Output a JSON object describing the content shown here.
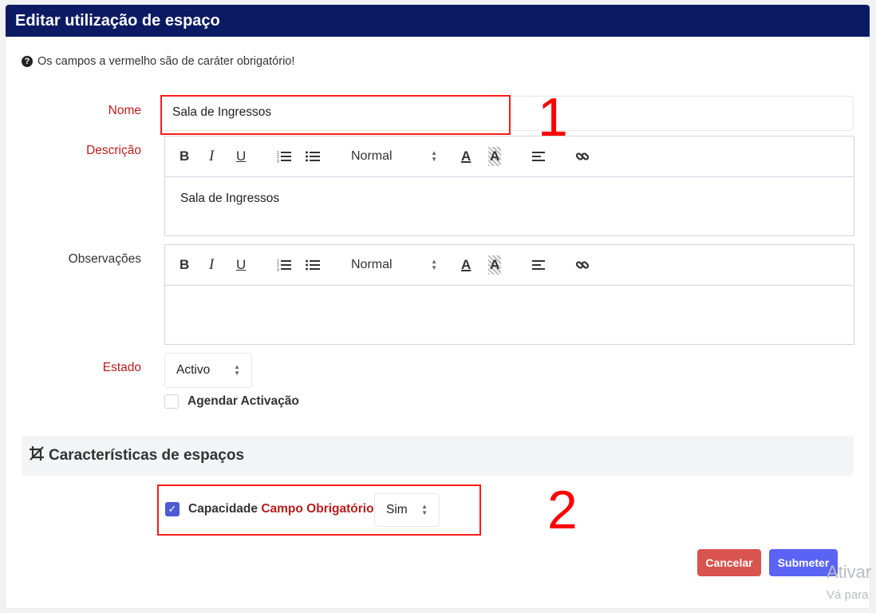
{
  "header": {
    "title": "Editar utilização de espaço"
  },
  "help": {
    "icon": "question-circle-icon",
    "text": "Os campos a vermelho são de caráter obrigatório!"
  },
  "form": {
    "nome": {
      "label": "Nome",
      "value": "Sala de Ingressos"
    },
    "descricao": {
      "label": "Descrição",
      "value": "Sala de Ingressos"
    },
    "observacoes": {
      "label": "Observações",
      "value": ""
    },
    "toolbar": {
      "bold": "B",
      "italic": "I",
      "underline": "U",
      "size": "Normal",
      "color": "A",
      "background": "A"
    },
    "estado": {
      "label": "Estado",
      "value": "Activo"
    },
    "agendar": {
      "label": "Agendar Activação",
      "checked": false
    }
  },
  "section": {
    "icon": "crop-icon",
    "title": "Características de espaços"
  },
  "capacidade": {
    "label": "Capacidade",
    "required_label": "Campo Obrigatório",
    "value": "Sim",
    "checked": true
  },
  "buttons": {
    "cancel": "Cancelar",
    "submit": "Submeter"
  },
  "annotations": {
    "one": "1",
    "two": "2"
  },
  "watermark": {
    "line1": "Ativar",
    "line2": "Vá para"
  },
  "colors": {
    "header": "#0b1a63",
    "required": "#b91c1c",
    "cancel": "#d9534f",
    "submit": "#5b63f5",
    "annotation": "#ff0000"
  }
}
